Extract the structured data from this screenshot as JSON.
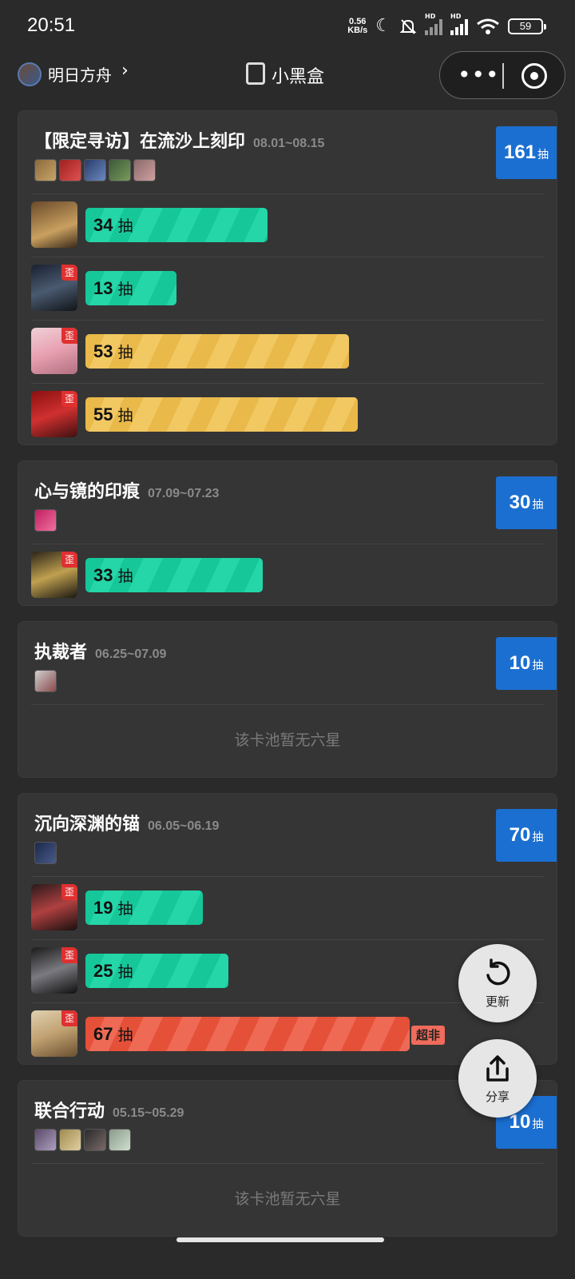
{
  "status_bar": {
    "time": "20:51",
    "net_speed_value": "0.56",
    "net_speed_unit": "KB/s",
    "signal_label": "HD",
    "battery": "59"
  },
  "nav": {
    "game_name": "明日方舟",
    "chevron": "›",
    "app_title": "小黑盒",
    "more": "•••"
  },
  "pools": [
    {
      "title": "【限定寻访】在流沙上刻印",
      "date": "08.01~08.15",
      "total": "161",
      "total_unit": "抽",
      "pulls": [
        {
          "count": "34",
          "unit": "抽",
          "off_banner": false,
          "rarity_color": "green",
          "fraction": 0.34
        },
        {
          "count": "13",
          "unit": "抽",
          "off_banner": true,
          "badge": "歪",
          "rarity_color": "green",
          "fraction": 0.13
        },
        {
          "count": "53",
          "unit": "抽",
          "off_banner": true,
          "badge": "歪",
          "rarity_color": "yellow",
          "fraction": 0.53
        },
        {
          "count": "55",
          "unit": "抽",
          "off_banner": true,
          "badge": "歪",
          "rarity_color": "yellow",
          "fraction": 0.55
        }
      ]
    },
    {
      "title": "心与镜的印痕",
      "date": "07.09~07.23",
      "total": "30",
      "total_unit": "抽",
      "pulls": [
        {
          "count": "33",
          "unit": "抽",
          "off_banner": true,
          "badge": "歪",
          "rarity_color": "green",
          "fraction": 0.33
        }
      ]
    },
    {
      "title": "执裁者",
      "date": "06.25~07.09",
      "total": "10",
      "total_unit": "抽",
      "empty_text": "该卡池暂无六星"
    },
    {
      "title": "沉向深渊的锚",
      "date": "06.05~06.19",
      "total": "70",
      "total_unit": "抽",
      "pulls": [
        {
          "count": "19",
          "unit": "抽",
          "off_banner": true,
          "badge": "歪",
          "rarity_color": "green",
          "fraction": 0.19
        },
        {
          "count": "25",
          "unit": "抽",
          "off_banner": true,
          "badge": "歪",
          "rarity_color": "green",
          "fraction": 0.25
        },
        {
          "count": "67",
          "unit": "抽",
          "off_banner": true,
          "badge": "歪",
          "rarity_color": "red",
          "fraction": 0.67,
          "tag": "超非"
        }
      ]
    },
    {
      "title": "联合行动",
      "date": "05.15~05.29",
      "total": "10",
      "total_unit": "抽",
      "empty_text": "该卡池暂无六星"
    }
  ],
  "fabs": {
    "refresh_label": "更新",
    "share_label": "分享"
  },
  "colors": {
    "total_badge": "#1b6fd1",
    "bar_green": "#16c79a",
    "bar_yellow": "#e9b949",
    "bar_red": "#e55039",
    "off_banner_badge": "#e03030"
  }
}
